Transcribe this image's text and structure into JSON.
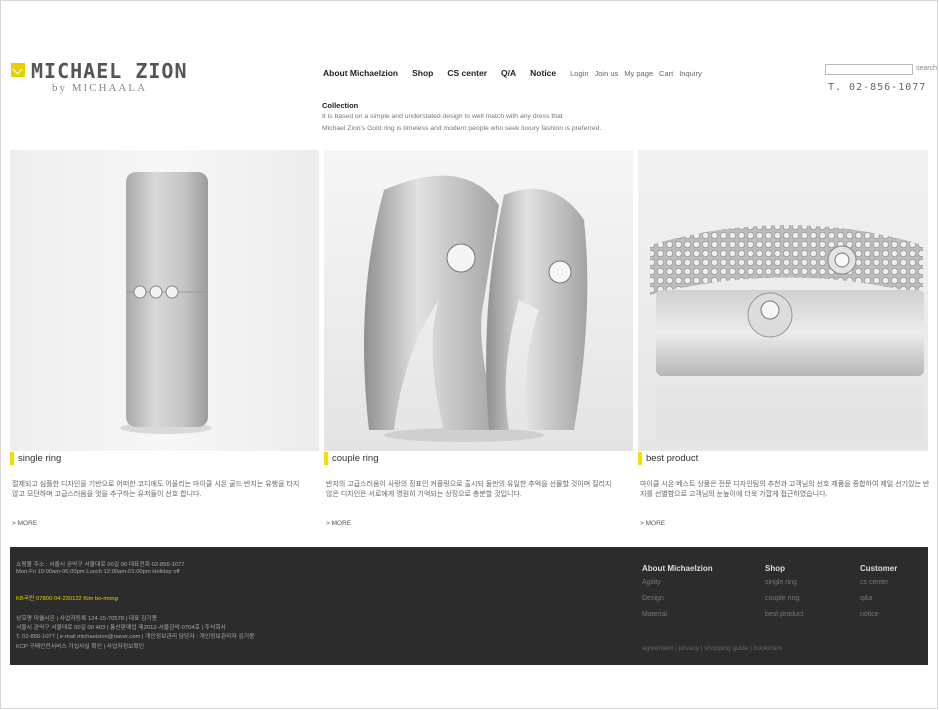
{
  "header": {
    "brand": "MICHAEL ZION",
    "brand_sub": "by MICHAALA",
    "phone": "T. 02-856-1077",
    "search_label": "search",
    "nav_main": [
      "About Michaelzion",
      "Shop",
      "CS center",
      "Q/A",
      "Notice"
    ],
    "nav_util": [
      "Login",
      "Join us",
      "My page",
      "Cart",
      "Inquiry"
    ]
  },
  "collection": {
    "title": "Collection",
    "line1": "It is based on a simple and understated design to well match with any dress that",
    "line2": "Michael Zion's Gold ring is timeless and modern people who seek luxury fashion is preferred."
  },
  "products": [
    {
      "label": "single ring",
      "desc": "절제되고 심플한 디자인을 기반으로 어떠한 코디에도 어울리는 마이클 시온 골드 반지는 유행을 타지 않고 모던하며 고급스러움을 멋을 추구하는 유저들이 선호 합니다.",
      "more": "> MORE"
    },
    {
      "label": "couple ring",
      "desc": "반지의 고급스러움이 사랑의 징표인 커플링으로 출시되 둘만의 유일한 추억을 선물할 것이며 질리지 않은 디자인은 서로에게 영원히 기억되는 상징으로 충분할 것입니다.",
      "more": "> MORE"
    },
    {
      "label": "best product",
      "desc": "마이클 시온 베스트 상품은 전문 디자인팀의 추천과 고객님의 선호 제품을 종합하여 제일 선기있는 반지를 선별함으로 고객님의 눈높이에 더욱 가깝게 접근하였습니다.",
      "more": "> MORE"
    }
  ],
  "footer": {
    "lines": [
      "쇼핑몰 주소 : 서울시 관악구 서울대로 00길 00 대표전화 02-856-1077",
      "Mon-Fri 10:00am-06:00pm  Lunch 12:00am-01:00pm  Holiday off",
      "KB국민 07800-04-230122  Kim bo-mong",
      "상호명 미쉘시온 | 사업자등록 124-15-70578 | 대표 김기봉",
      "서울시 관악구 서울대로 00길 00 403 | 통신판매업 제2012-서울관악-0704호 | 주식회사",
      "T. 02-856-1077 | e-mail michaelzion@naver.com | 개인정보관리 담당자 : 개인정보관리자 김기봉",
      "KCP 구매안전서비스 가입사실 확인 | 사업자정보확인"
    ],
    "columns": [
      {
        "head": "About Michaelzion",
        "items": [
          "Agility",
          "Design",
          "Material"
        ]
      },
      {
        "head": "Shop",
        "items": [
          "single ring",
          "couple ring",
          "best product"
        ]
      },
      {
        "head": "Customer",
        "items": [
          "cs center",
          "q&a",
          "notice"
        ]
      }
    ],
    "bottom_links": "agreement | privacy | shopping guide | bookmark"
  },
  "colors": {
    "accent": "#f2e000",
    "footer_bg": "#2c2c2c"
  }
}
